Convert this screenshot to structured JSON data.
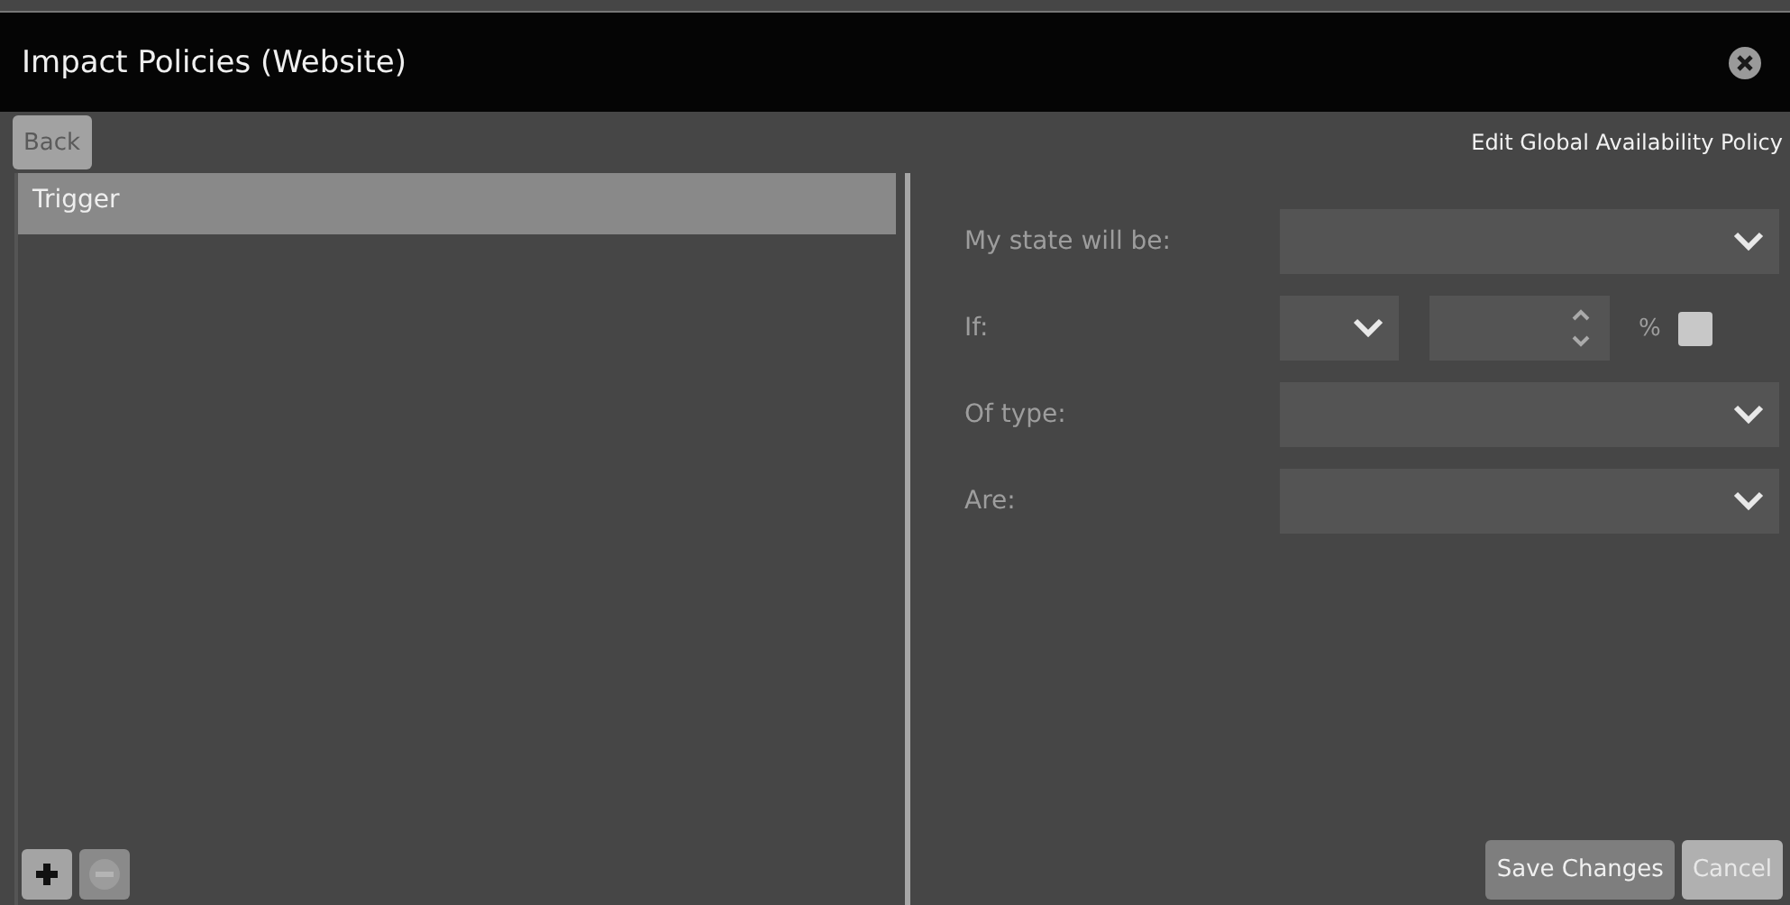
{
  "window": {
    "title": "Impact Policies (Website)"
  },
  "toolbar": {
    "back": "Back",
    "heading": "Edit Global Availability Policy"
  },
  "list": {
    "items": [
      {
        "label": "Trigger",
        "selected": true
      }
    ],
    "add": {
      "disabled": false
    },
    "remove": {
      "disabled": true
    }
  },
  "form": {
    "rows": [
      {
        "kind": "select",
        "label": "My state will be:"
      },
      {
        "kind": "condition",
        "label": "If:",
        "unit": "%",
        "checked": false
      },
      {
        "kind": "select",
        "label": "Of type:"
      },
      {
        "kind": "select",
        "label": "Are:"
      }
    ]
  },
  "buttons": [
    {
      "label": "Save Changes",
      "disabled": true
    },
    {
      "label": "Cancel",
      "disabled": false
    }
  ]
}
